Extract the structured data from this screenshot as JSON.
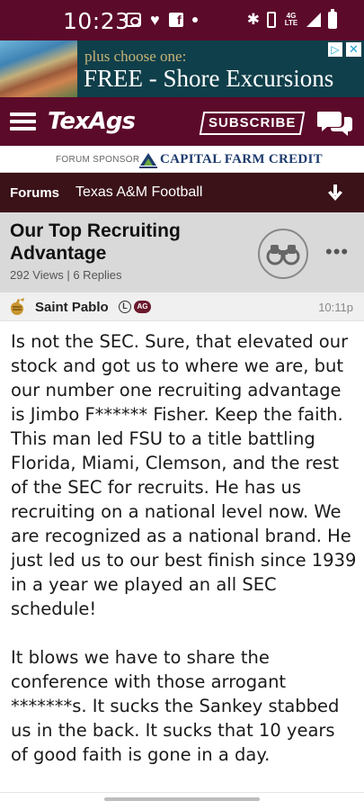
{
  "status_bar": {
    "time": "10:23",
    "network": "4G LTE",
    "icons": [
      "camera-icon",
      "heart-icon",
      "facebook-icon",
      "dot-icon",
      "bluetooth-icon",
      "vibrate-icon",
      "signal-icon",
      "battery-icon"
    ]
  },
  "ad": {
    "line1": "plus choose one:",
    "line2": "FREE - Shore Excursions",
    "choices_symbol": "▷",
    "close_symbol": "✕"
  },
  "header": {
    "logo": "TexAgs",
    "subscribe_label": "SUBSCRIBE",
    "background_color": "#5c0a2a"
  },
  "sponsor": {
    "label": "FORUM SPONSOR",
    "name": "CAPITAL FARM CREDIT"
  },
  "breadcrumb": {
    "forums_label": "Forums",
    "board_label": "Texas A&M Football"
  },
  "thread": {
    "title": "Our Top Recruiting Advantage",
    "meta": "292 Views | 6 Replies",
    "more_symbol": "•••"
  },
  "post": {
    "author": "Saint Pablo",
    "badge_l": "L",
    "badge_ag": "AG",
    "time": "10:11p",
    "paragraphs": [
      "Is not the SEC. Sure, that elevated our stock and got us to where we are, but our number one recruiting advantage is Jimbo F****** Fisher. Keep the faith. This man led FSU to a title battling Florida, Miami, Clemson, and the rest of the SEC for recruits. He has us recruiting on a national level now. We are recognized as a national brand. He just led us to our best finish since 1939 in a year we played an all SEC schedule!",
      "It blows we have to share the conference with those arrogant *******s. It sucks the Sankey stabbed us in the back. It sucks that 10 years of good faith is gone in a day."
    ]
  }
}
